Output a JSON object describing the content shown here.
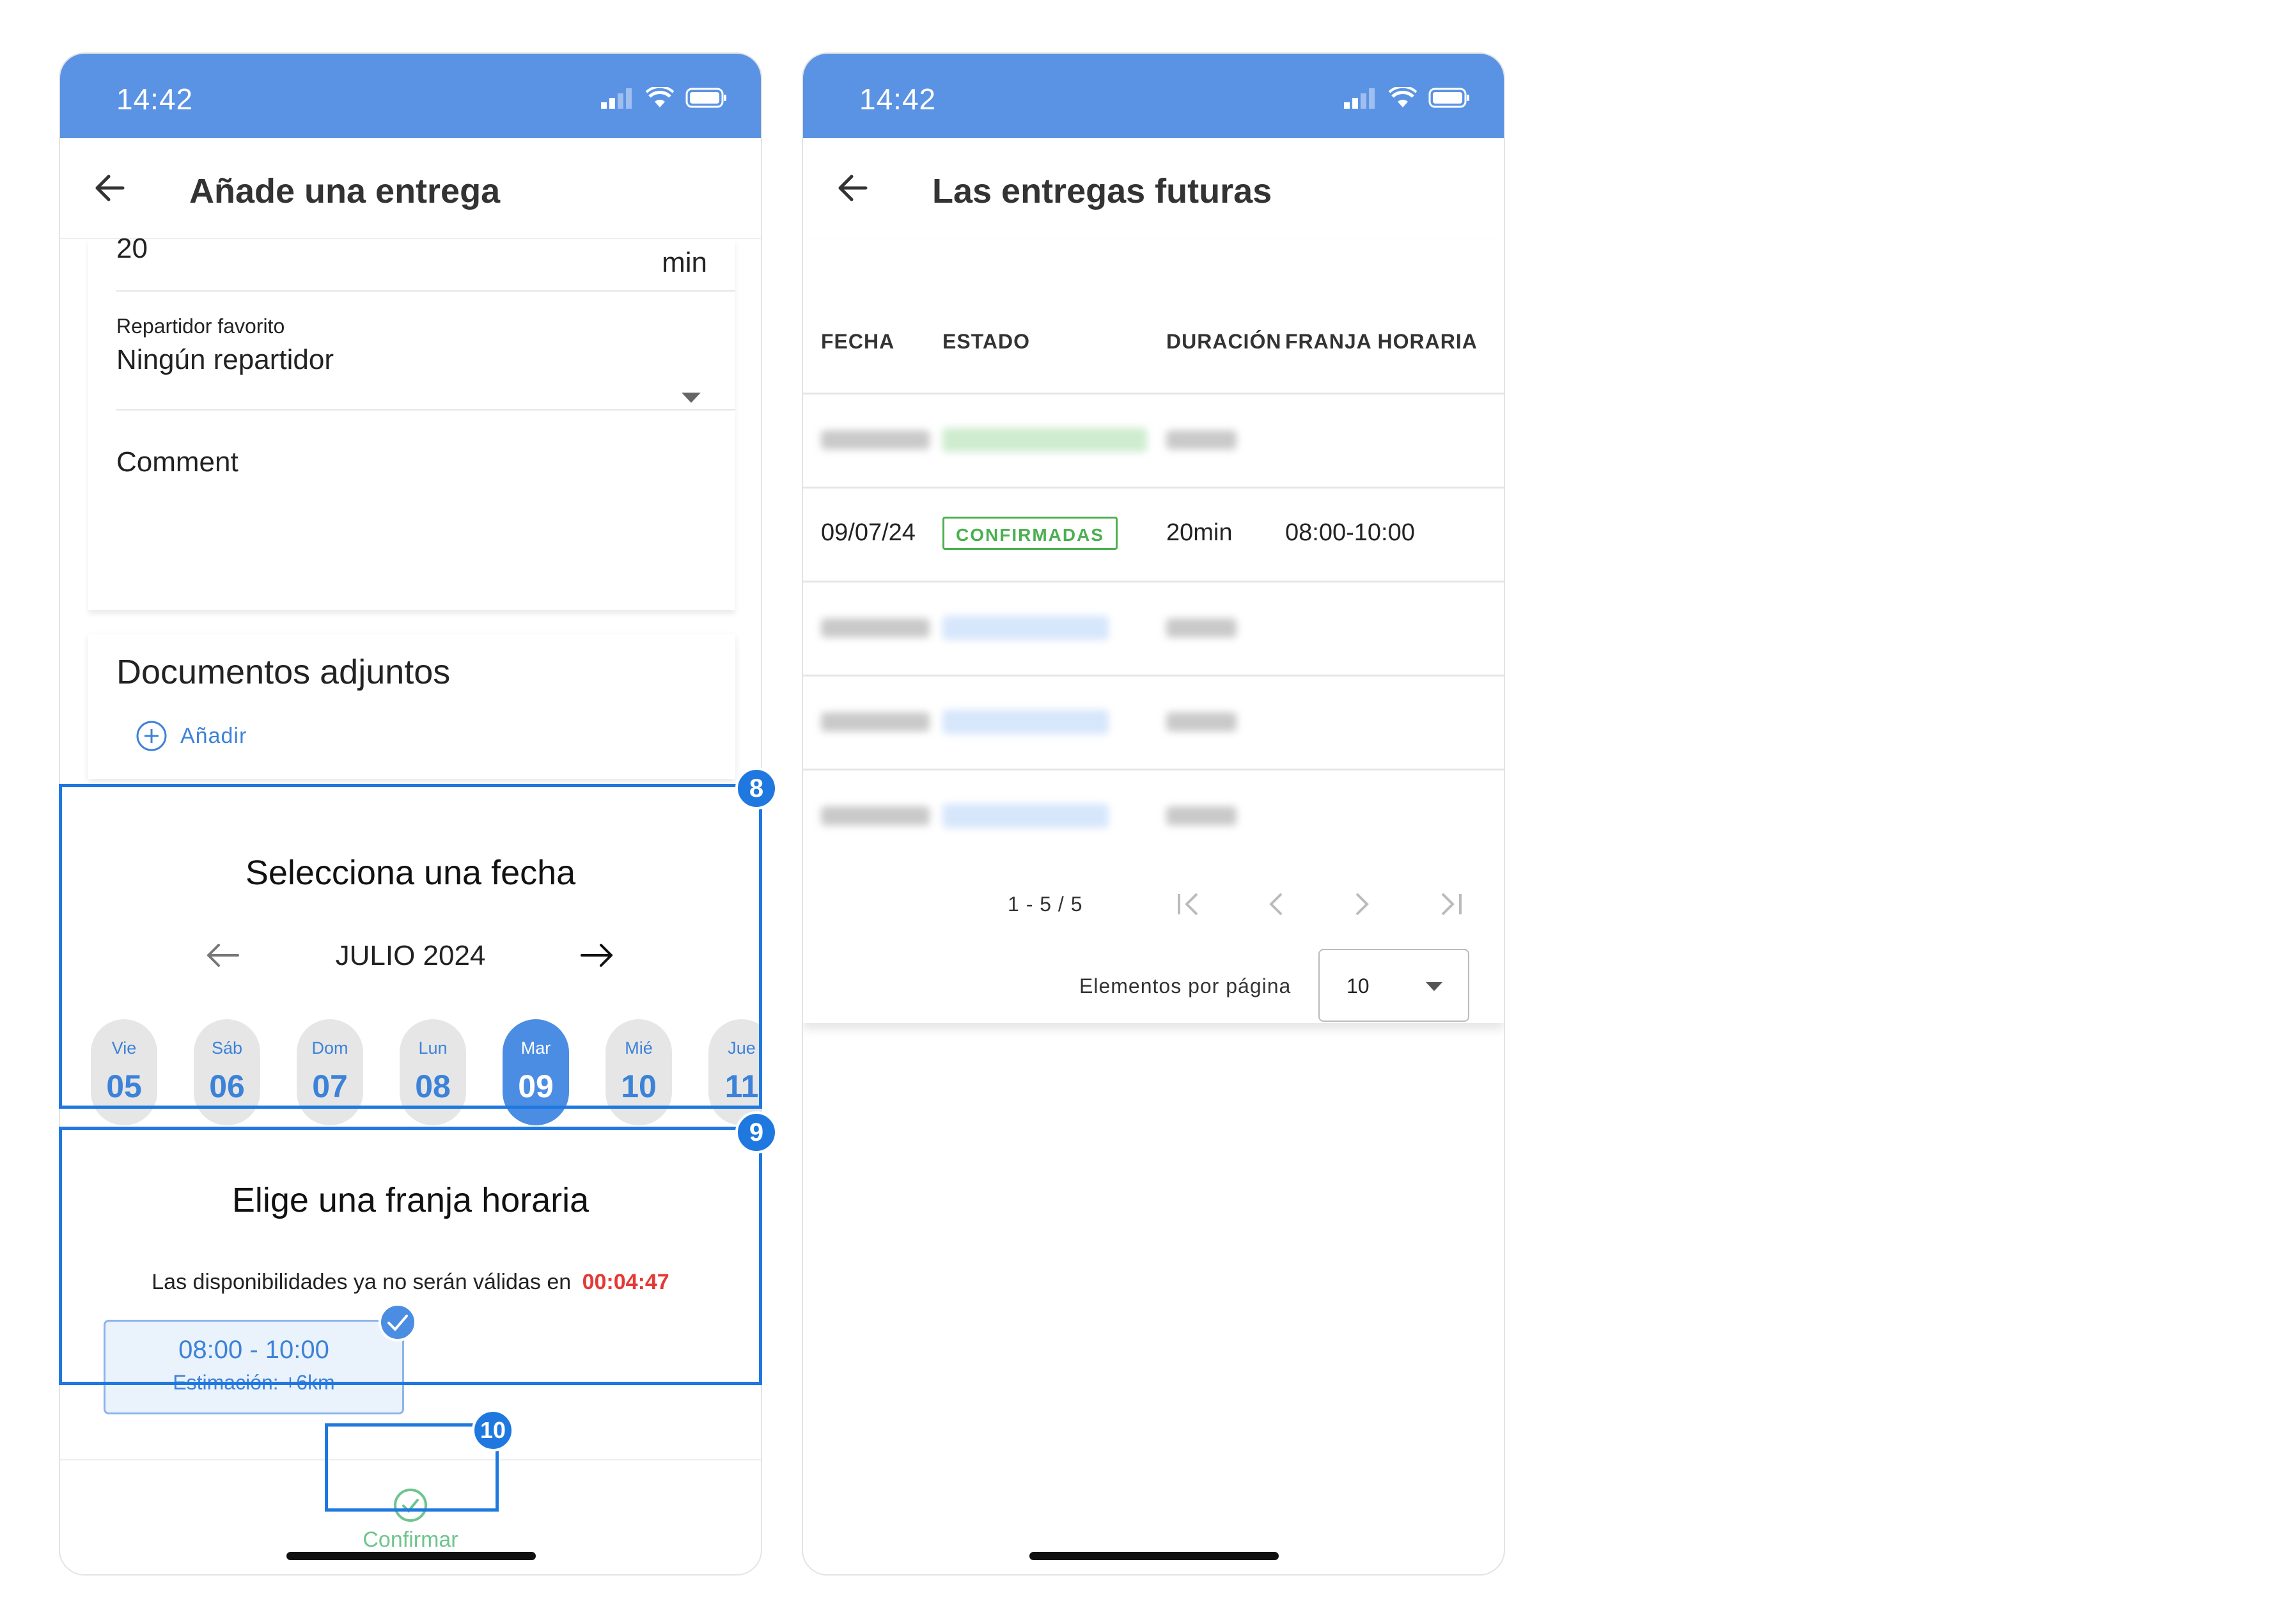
{
  "left_screen": {
    "status_time": "14:42",
    "title": "Añade una entrega",
    "duration_value": "20",
    "duration_unit": "min",
    "fav_label": "Repartidor favorito",
    "fav_value": "Ningún repartidor",
    "comment_label": "Comment",
    "docs_title": "Documentos adjuntos",
    "docs_add": "Añadir",
    "date_title": "Selecciona una fecha",
    "month_label": "JULIO 2024",
    "days": [
      {
        "name": "Vie",
        "num": "05"
      },
      {
        "name": "Sáb",
        "num": "06"
      },
      {
        "name": "Dom",
        "num": "07"
      },
      {
        "name": "Lun",
        "num": "08"
      },
      {
        "name": "Mar",
        "num": "09"
      },
      {
        "name": "Mié",
        "num": "10"
      },
      {
        "name": "Jue",
        "num": "11"
      }
    ],
    "selected_day_index": 4,
    "slot_title": "Elige una franja horaria",
    "validity_text": "Las disponibilidades ya no serán válidas en",
    "countdown": "00:04:47",
    "slot_time": "08:00 - 10:00",
    "slot_estimate": "Estimación:  +6km",
    "confirm_label": "Confirmar",
    "badges": {
      "date": "8",
      "slot": "9",
      "confirm": "10"
    }
  },
  "right_screen": {
    "status_time": "14:42",
    "title": "Las entregas futuras",
    "columns": [
      "FECHA",
      "ESTADO",
      "DURACIÓN",
      "FRANJA HORARIA"
    ],
    "visible_row": {
      "date": "09/07/24",
      "status": "CONFIRMADAS",
      "duration": "20min",
      "slot": "08:00-10:00"
    },
    "pagination": "1 - 5 / 5",
    "per_page_label": "Elementos por página",
    "per_page_value": "10"
  },
  "colors": {
    "status_bar": "#5b93e4",
    "accent_blue": "#1f78e0",
    "confirmed_green": "#4caf50",
    "countdown_red": "#e53935"
  }
}
